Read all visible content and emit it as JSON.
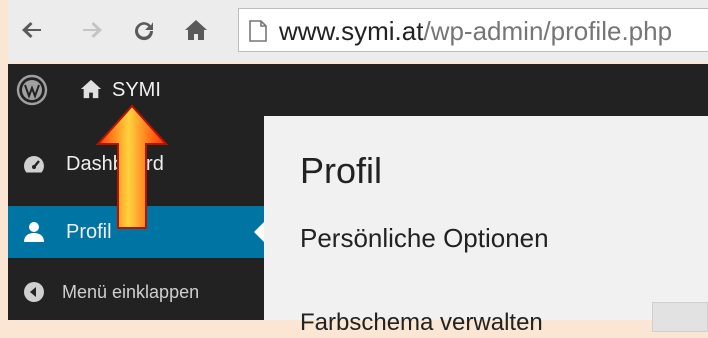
{
  "browser": {
    "url_host": "www.symi.at",
    "url_path": "/wp-admin/profile.php"
  },
  "adminbar": {
    "site_name": "SYMI"
  },
  "menu": {
    "items": [
      {
        "label": "Dashboard",
        "icon": "dashboard-icon"
      },
      {
        "label": "Profil",
        "icon": "user-icon",
        "current": true
      },
      {
        "label": "Menü einklappen",
        "icon": "collapse-icon"
      }
    ]
  },
  "content": {
    "title": "Profil",
    "section": "Persönliche Optionen",
    "partial_row": "Farbschema verwalten"
  },
  "colors": {
    "adminbar": "#222222",
    "menu_current": "#0074a2",
    "arrow_fill": "#ff2a00",
    "arrow_highlight": "#ffd23c",
    "page_background": "#fbe6d3"
  }
}
